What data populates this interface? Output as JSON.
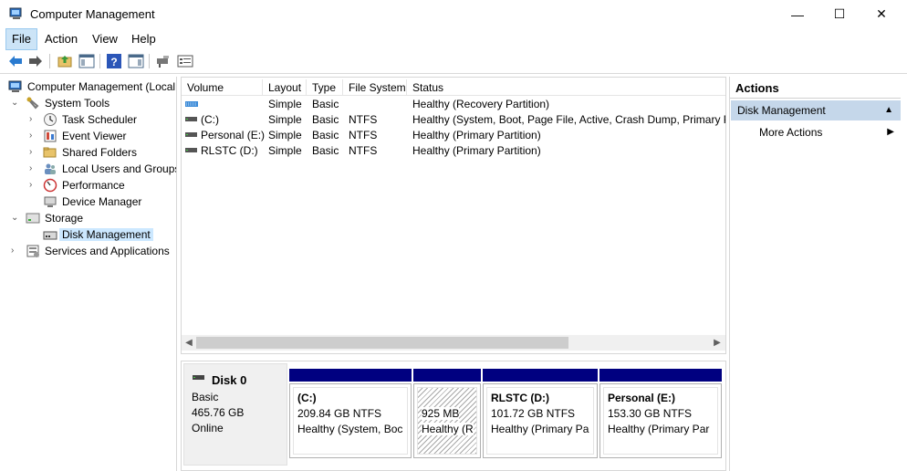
{
  "window": {
    "title": "Computer Management",
    "minimize_glyph": "—",
    "maximize_glyph": "☐",
    "close_glyph": "✕"
  },
  "menu": [
    "File",
    "Action",
    "View",
    "Help"
  ],
  "toolbar": {
    "icons": [
      "back-icon",
      "forward-icon",
      "up-folder-icon",
      "show-hide-tree-icon",
      "help-icon",
      "show-hide-action-pane-icon",
      "connect-icon",
      "properties-icon"
    ]
  },
  "tree": {
    "items": [
      {
        "label": "Computer Management (Local",
        "icon": "computer-management-icon",
        "expander": ""
      },
      {
        "label": "System Tools",
        "icon": "system-tools-icon",
        "expander": "⌄"
      },
      {
        "label": "Task Scheduler",
        "icon": "task-scheduler-icon",
        "expander": "›"
      },
      {
        "label": "Event Viewer",
        "icon": "event-viewer-icon",
        "expander": "›"
      },
      {
        "label": "Shared Folders",
        "icon": "shared-folders-icon",
        "expander": "›"
      },
      {
        "label": "Local Users and Groups",
        "icon": "local-users-icon",
        "expander": "›"
      },
      {
        "label": "Performance",
        "icon": "performance-icon",
        "expander": "›"
      },
      {
        "label": "Device Manager",
        "icon": "device-manager-icon",
        "expander": ""
      },
      {
        "label": "Storage",
        "icon": "storage-icon",
        "expander": "⌄"
      },
      {
        "label": "Disk Management",
        "icon": "disk-management-icon",
        "expander": ""
      },
      {
        "label": "Services and Applications",
        "icon": "services-icon",
        "expander": "›"
      }
    ]
  },
  "volumes": {
    "columns": [
      "Volume",
      "Layout",
      "Type",
      "File System",
      "Status"
    ],
    "rows": [
      {
        "volume": "",
        "layout": "Simple",
        "type": "Basic",
        "fs": "",
        "status": "Healthy (Recovery Partition)"
      },
      {
        "volume": "(C:)",
        "layout": "Simple",
        "type": "Basic",
        "fs": "NTFS",
        "status": "Healthy (System, Boot, Page File, Active, Crash Dump, Primary Pa"
      },
      {
        "volume": "Personal (E:)",
        "layout": "Simple",
        "type": "Basic",
        "fs": "NTFS",
        "status": "Healthy (Primary Partition)"
      },
      {
        "volume": "RLSTC (D:)",
        "layout": "Simple",
        "type": "Basic",
        "fs": "NTFS",
        "status": "Healthy (Primary Partition)"
      }
    ]
  },
  "disk": {
    "name": "Disk 0",
    "type": "Basic",
    "size": "465.76 GB",
    "state": "Online",
    "partitions": [
      {
        "title": "(C:)",
        "size": "209.84 GB NTFS",
        "status": "Healthy (System, Boc"
      },
      {
        "title": "",
        "size": "925 MB",
        "status": "Healthy (R"
      },
      {
        "title": "RLSTC  (D:)",
        "size": "101.72 GB NTFS",
        "status": "Healthy (Primary Pa"
      },
      {
        "title": "Personal  (E:)",
        "size": "153.30 GB NTFS",
        "status": "Healthy (Primary Par"
      }
    ]
  },
  "actions": {
    "title": "Actions",
    "section": "Disk Management",
    "more": "More Actions"
  },
  "colors": {
    "partition_bar": "#000080",
    "section_bg": "#c5d7ea",
    "selection_bg": "#cce8ff"
  }
}
